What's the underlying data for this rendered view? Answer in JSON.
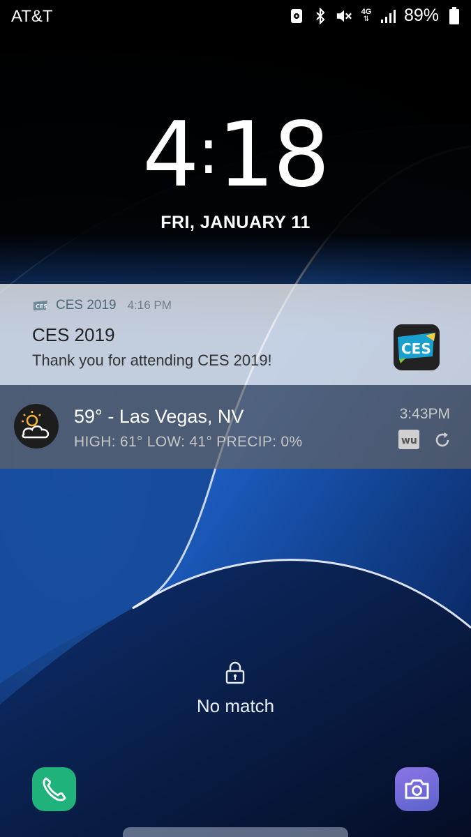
{
  "status_bar": {
    "carrier": "AT&T",
    "network": "4G",
    "battery_percent": "89%"
  },
  "clock": {
    "hours": "4",
    "minutes": "18",
    "date": "FRI, JANUARY 11"
  },
  "notifications": {
    "ces": {
      "app_name": "CES 2019",
      "time": "4:16 PM",
      "title": "CES 2019",
      "body": "Thank you for attending CES 2019!",
      "icon_text": "CES"
    },
    "weather": {
      "title": "59° - Las Vegas, NV",
      "subtitle": "HIGH: 61° LOW: 41° PRECIP: 0%",
      "time": "3:43PM",
      "wu_label": "wu"
    }
  },
  "lock": {
    "message": "No match"
  },
  "colors": {
    "phone_green": "#1fb27a",
    "camera_purple": "#7a6ad9",
    "wallpaper_blue": "#1a4a9e"
  }
}
